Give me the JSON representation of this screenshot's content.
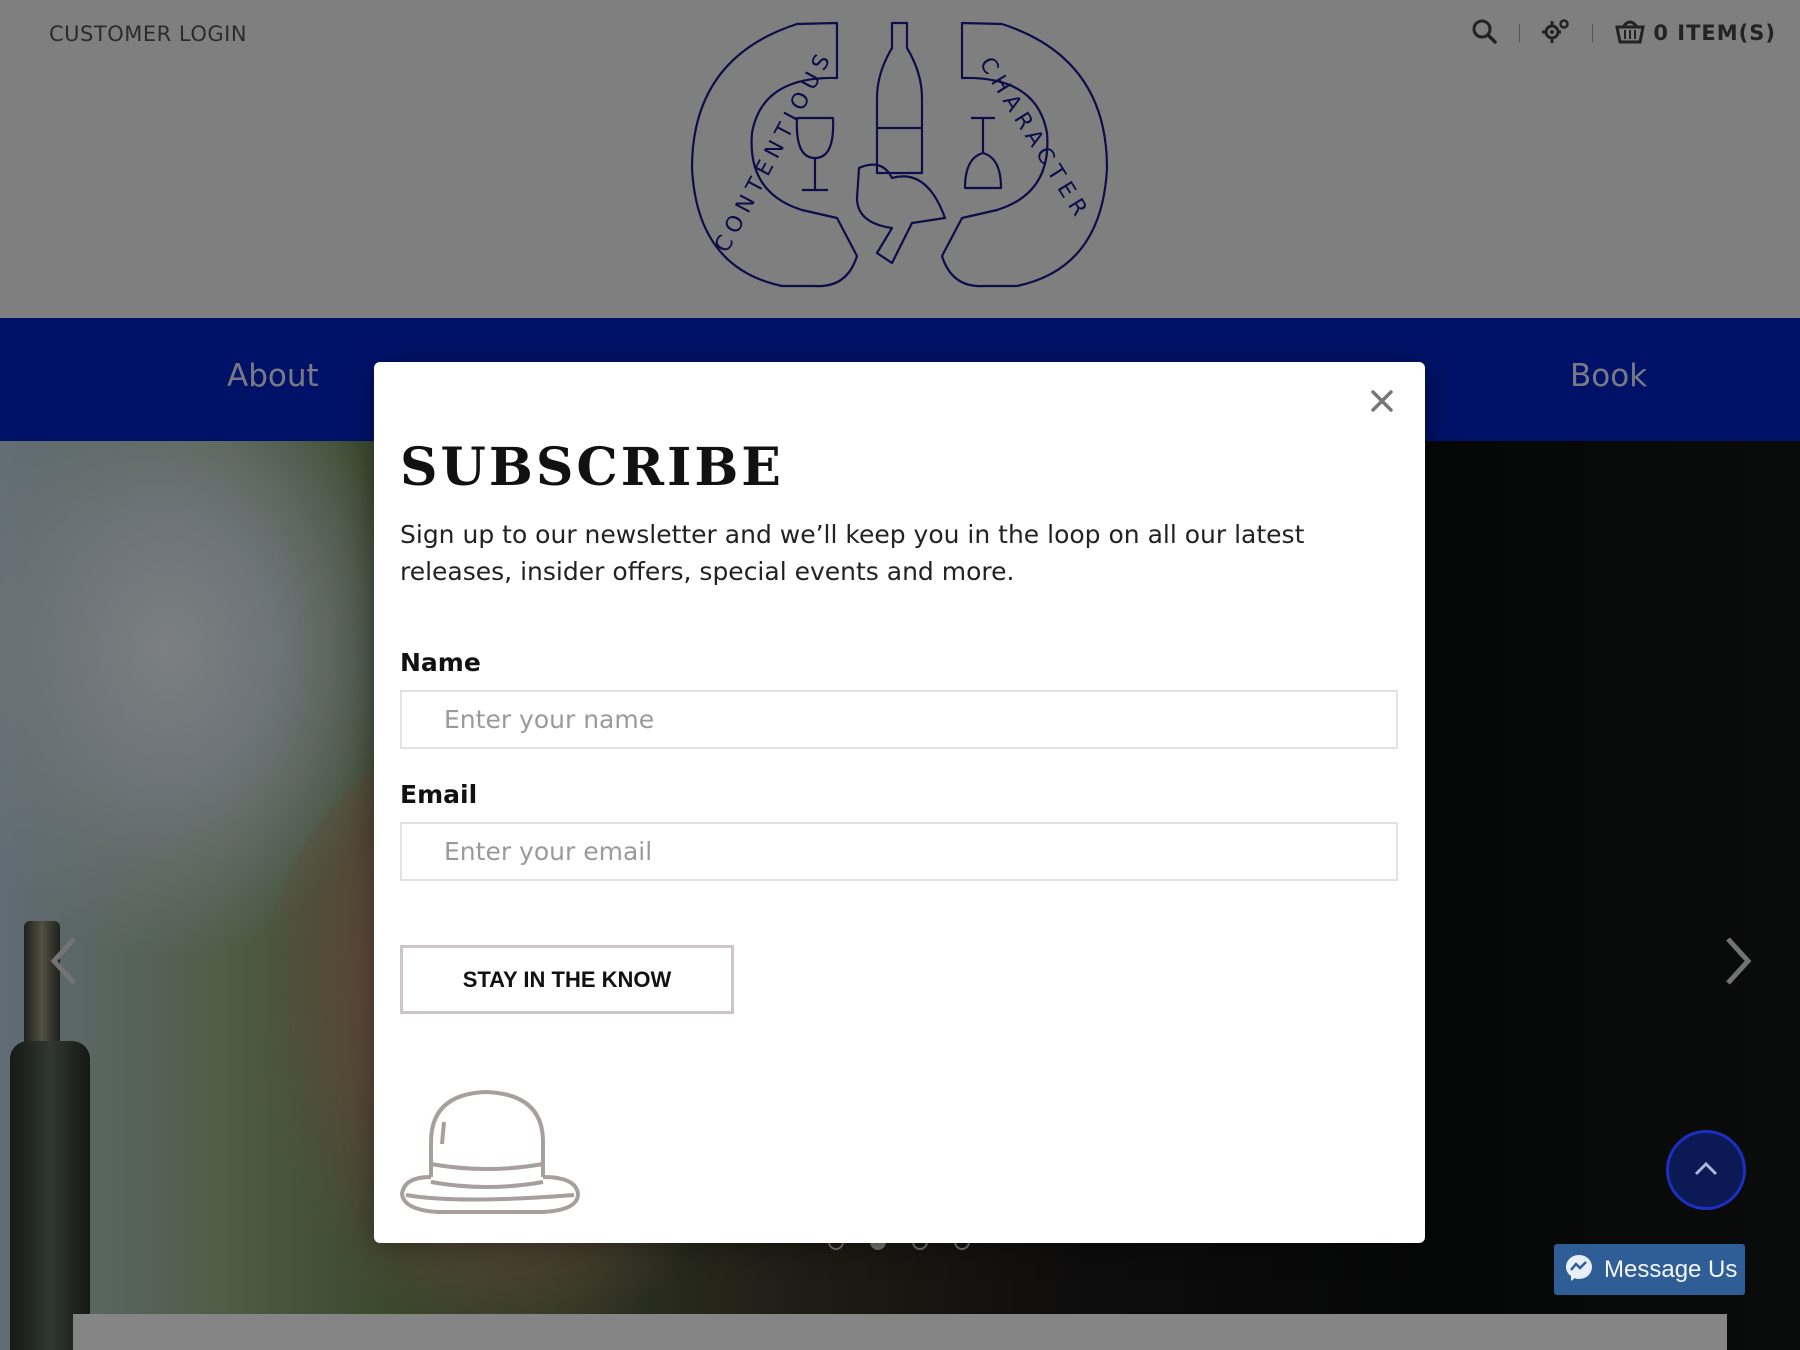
{
  "header": {
    "customer_login": "CUSTOMER LOGIN",
    "cart_count": "0 ITEM(S)",
    "logo_text_left": "CONTENTIOUS",
    "logo_text_right": "CHARACTER"
  },
  "nav": {
    "items": [
      {
        "label": "About"
      },
      {
        "label": "Book"
      }
    ]
  },
  "hero": {
    "active_slide": 2,
    "slide_count": 4
  },
  "modal": {
    "title": "SUBSCRIBE",
    "description": "Sign up to our newsletter and we’ll keep you in the loop on all our latest releases, insider offers, special events and more.",
    "name_label": "Name",
    "name_placeholder": "Enter your name",
    "email_label": "Email",
    "email_placeholder": "Enter your email",
    "submit_label": "STAY IN THE KNOW"
  },
  "widgets": {
    "messenger_label": "Message Us"
  },
  "colors": {
    "nav_bg": "#0022c8",
    "logo_stroke": "#1a1a8c",
    "messenger_bg": "#2f5d96"
  },
  "icons": [
    "search-icon",
    "settings-gear-icon",
    "cart-basket-icon",
    "close-icon",
    "chevron-left-icon",
    "chevron-right-icon",
    "chevron-up-icon",
    "messenger-icon",
    "bowler-hat-icon"
  ]
}
